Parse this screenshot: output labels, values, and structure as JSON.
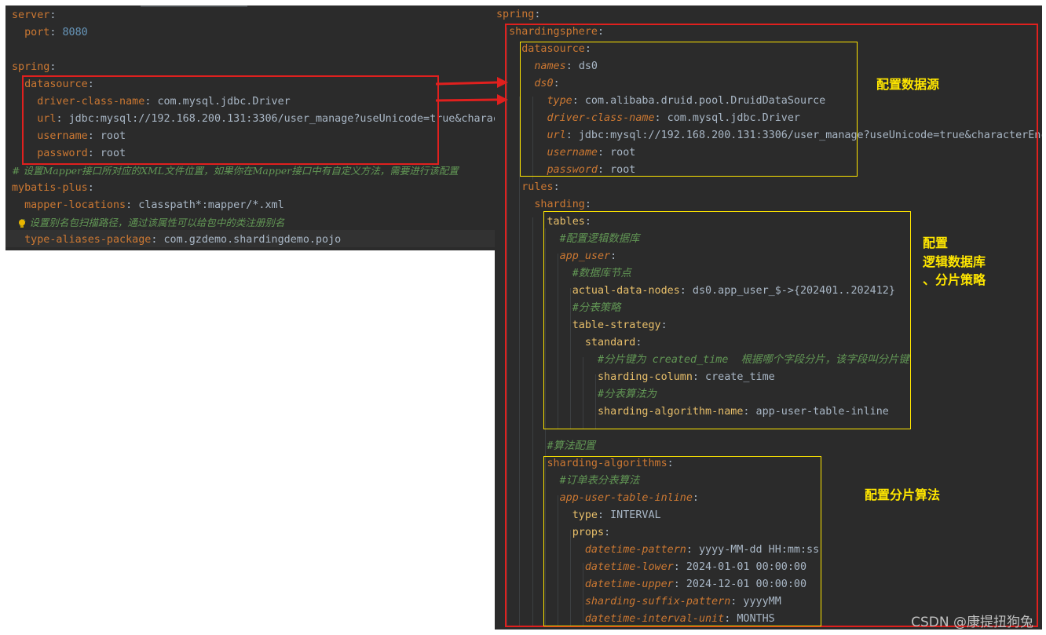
{
  "left_editor": {
    "lines": [
      [
        {
          "t": "server",
          "c": "k"
        },
        {
          "t": ":",
          "c": "p"
        }
      ],
      [
        {
          "t": "  port",
          "c": "k"
        },
        {
          "t": ": ",
          "c": "p"
        },
        {
          "t": "8080",
          "c": "num"
        }
      ],
      [],
      [
        {
          "t": "spring",
          "c": "k"
        },
        {
          "t": ":",
          "c": "p"
        }
      ],
      [
        {
          "t": "  datasource",
          "c": "k"
        },
        {
          "t": ":",
          "c": "p"
        }
      ],
      [
        {
          "t": "    driver-class-name",
          "c": "k"
        },
        {
          "t": ": ",
          "c": "p"
        },
        {
          "t": "com.mysql.jdbc.Driver",
          "c": "v"
        }
      ],
      [
        {
          "t": "    url",
          "c": "k"
        },
        {
          "t": ": ",
          "c": "p"
        },
        {
          "t": "jdbc:mysql://192.168.200.131:3306/user_manage?useUnicode=true&charac",
          "c": "v"
        }
      ],
      [
        {
          "t": "    username",
          "c": "k"
        },
        {
          "t": ": ",
          "c": "p"
        },
        {
          "t": "root",
          "c": "v"
        }
      ],
      [
        {
          "t": "    password",
          "c": "k"
        },
        {
          "t": ": ",
          "c": "p"
        },
        {
          "t": "root",
          "c": "v"
        }
      ],
      [
        {
          "t": "# 设置Mapper接口所对应的XML文件位置，如果你在Mapper接口中有自定义方法，需要进行该配置",
          "c": "c"
        }
      ],
      [
        {
          "t": "mybatis-plus",
          "c": "k"
        },
        {
          "t": ":",
          "c": "p"
        }
      ],
      [
        {
          "t": "  mapper-locations",
          "c": "k"
        },
        {
          "t": ": ",
          "c": "p"
        },
        {
          "t": "classpath*:mapper/*.xml",
          "c": "v"
        }
      ],
      [
        {
          "t": "  # 设置别名包扫描路径，通过该属性可以给包中的类注册别名",
          "c": "c"
        }
      ],
      [
        {
          "t": "  type-aliases-package",
          "c": "k"
        },
        {
          "t": ": ",
          "c": "p"
        },
        {
          "t": "com.gzdemo.shardingdemo.pojo",
          "c": "v"
        }
      ]
    ]
  },
  "right_editor": {
    "lines": [
      [
        {
          "t": "spring",
          "c": "k"
        },
        {
          "t": ":",
          "c": "p"
        }
      ],
      [
        {
          "t": "  shardingsphere",
          "c": "k"
        },
        {
          "t": ":",
          "c": "p"
        }
      ],
      [
        {
          "t": "    datasource",
          "c": "k"
        },
        {
          "t": ":",
          "c": "p"
        }
      ],
      [
        {
          "t": "      names",
          "c": "ki"
        },
        {
          "t": ": ",
          "c": "p"
        },
        {
          "t": "ds0",
          "c": "v"
        }
      ],
      [
        {
          "t": "      ds0",
          "c": "ki"
        },
        {
          "t": ":",
          "c": "p"
        }
      ],
      [
        {
          "t": "        type",
          "c": "ki"
        },
        {
          "t": ": ",
          "c": "p"
        },
        {
          "t": "com.alibaba.druid.pool.DruidDataSource",
          "c": "v"
        }
      ],
      [
        {
          "t": "        driver-class-name",
          "c": "ki"
        },
        {
          "t": ": ",
          "c": "p"
        },
        {
          "t": "com.mysql.jdbc.Driver",
          "c": "v"
        }
      ],
      [
        {
          "t": "        url",
          "c": "ki"
        },
        {
          "t": ": ",
          "c": "p"
        },
        {
          "t": "jdbc:mysql://192.168.200.131:3306/user_manage?useUnicode=true&characterEnc",
          "c": "v"
        }
      ],
      [
        {
          "t": "        username",
          "c": "ki"
        },
        {
          "t": ": ",
          "c": "p"
        },
        {
          "t": "root",
          "c": "v"
        }
      ],
      [
        {
          "t": "        password",
          "c": "ki"
        },
        {
          "t": ": ",
          "c": "p"
        },
        {
          "t": "root",
          "c": "v"
        }
      ],
      [
        {
          "t": "    rules",
          "c": "k"
        },
        {
          "t": ":",
          "c": "p"
        }
      ],
      [
        {
          "t": "      sharding",
          "c": "k"
        },
        {
          "t": ":",
          "c": "p"
        }
      ],
      [
        {
          "t": "        tables",
          "c": "kb"
        },
        {
          "t": ":",
          "c": "p"
        }
      ],
      [
        {
          "t": "          #配置逻辑数据库",
          "c": "cm"
        }
      ],
      [
        {
          "t": "          app_user",
          "c": "ki"
        },
        {
          "t": ":",
          "c": "p"
        }
      ],
      [
        {
          "t": "            #数据库节点",
          "c": "cm"
        }
      ],
      [
        {
          "t": "            actual-data-nodes",
          "c": "kb"
        },
        {
          "t": ": ",
          "c": "p"
        },
        {
          "t": "ds0.app_user_$->{202401..202412}",
          "c": "v"
        }
      ],
      [
        {
          "t": "            #分表策略",
          "c": "cm"
        }
      ],
      [
        {
          "t": "            table-strategy",
          "c": "kb"
        },
        {
          "t": ":",
          "c": "p"
        }
      ],
      [
        {
          "t": "              standard",
          "c": "kb"
        },
        {
          "t": ":",
          "c": "p"
        }
      ],
      [
        {
          "t": "                #分片键为 created_time  根据哪个字段分片，该字段叫分片键",
          "c": "cm"
        }
      ],
      [
        {
          "t": "                sharding-column",
          "c": "kb"
        },
        {
          "t": ": ",
          "c": "p"
        },
        {
          "t": "create_time",
          "c": "v"
        }
      ],
      [
        {
          "t": "                #分表算法为",
          "c": "cm"
        }
      ],
      [
        {
          "t": "                sharding-algorithm-name",
          "c": "kb"
        },
        {
          "t": ": ",
          "c": "p"
        },
        {
          "t": "app-user-table-inline",
          "c": "v"
        }
      ],
      [],
      [
        {
          "t": "        #算法配置",
          "c": "cm"
        }
      ],
      [
        {
          "t": "        sharding-algorithms",
          "c": "k"
        },
        {
          "t": ":",
          "c": "p"
        }
      ],
      [
        {
          "t": "          #订单表分表算法",
          "c": "cm"
        }
      ],
      [
        {
          "t": "          app-user-table-inline",
          "c": "ki"
        },
        {
          "t": ":",
          "c": "p"
        }
      ],
      [
        {
          "t": "            type",
          "c": "kb"
        },
        {
          "t": ": ",
          "c": "p"
        },
        {
          "t": "INTERVAL",
          "c": "v"
        }
      ],
      [
        {
          "t": "            props",
          "c": "kb"
        },
        {
          "t": ":",
          "c": "p"
        }
      ],
      [
        {
          "t": "              datetime-pattern",
          "c": "ki"
        },
        {
          "t": ": ",
          "c": "p"
        },
        {
          "t": "yyyy-MM-dd HH:mm:ss",
          "c": "v"
        }
      ],
      [
        {
          "t": "              datetime-lower",
          "c": "ki"
        },
        {
          "t": ": ",
          "c": "p"
        },
        {
          "t": "2024-01-01 00:00:00",
          "c": "v"
        }
      ],
      [
        {
          "t": "              datetime-upper",
          "c": "ki"
        },
        {
          "t": ": ",
          "c": "p"
        },
        {
          "t": "2024-12-01 00:00:00",
          "c": "v"
        }
      ],
      [
        {
          "t": "              sharding-suffix-pattern",
          "c": "ki"
        },
        {
          "t": ": ",
          "c": "p"
        },
        {
          "t": "yyyyMM",
          "c": "v"
        }
      ],
      [
        {
          "t": "              datetime-interval-unit",
          "c": "ki"
        },
        {
          "t": ": ",
          "c": "p"
        },
        {
          "t": "MONTHS",
          "c": "v"
        }
      ]
    ]
  },
  "annotations": {
    "datasource": "配置数据源",
    "tables_line1": "配置",
    "tables_line2": "逻辑数据库",
    "tables_line3": "、分片策略",
    "algorithms": "配置分片算法"
  },
  "watermark": "CSDN @康提扭狗兔",
  "colors": {
    "highlight_red": "#e0201e",
    "highlight_yellow": "#ffe600",
    "editor_bg": "#2b2b2b"
  }
}
